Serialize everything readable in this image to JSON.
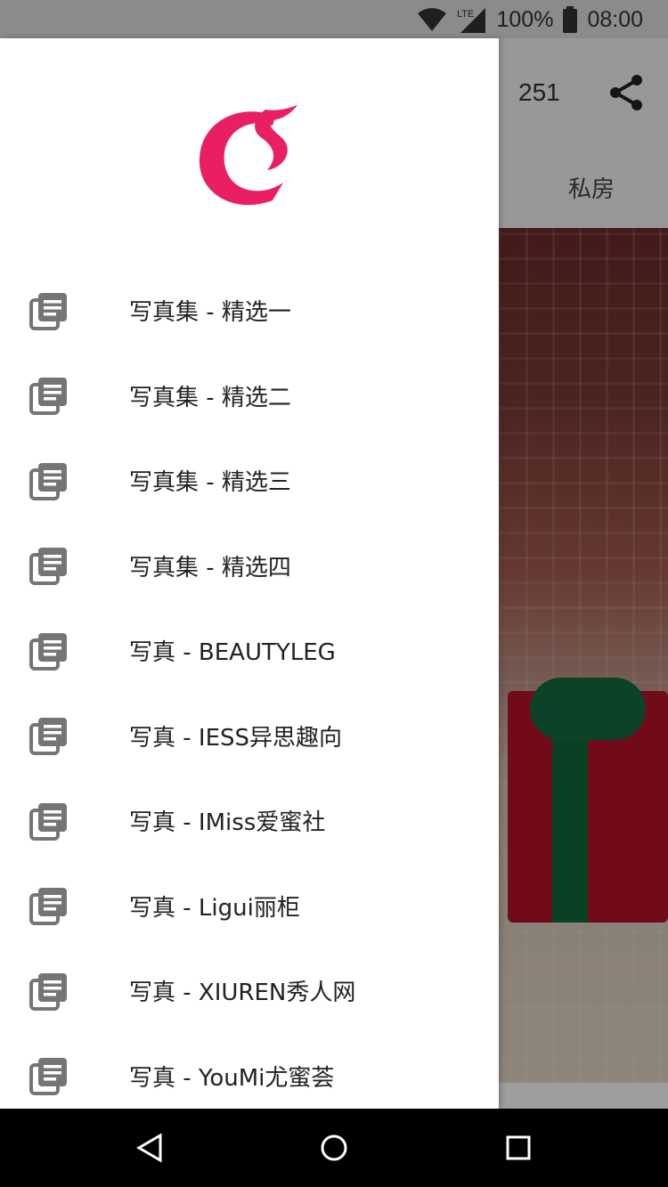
{
  "status_bar": {
    "battery_text": "100%",
    "time": "08:00",
    "network_label": "LTE",
    "icons": [
      "wifi-icon",
      "cell-signal-icon",
      "battery-icon"
    ]
  },
  "background_app": {
    "count_prefix": ":",
    "count": "251",
    "tab_label": "私房",
    "share_icon": "share-icon"
  },
  "drawer": {
    "logo": "app-logo",
    "items": [
      {
        "label": "写真集 - 精选一"
      },
      {
        "label": "写真集 - 精选二"
      },
      {
        "label": "写真集 - 精选三"
      },
      {
        "label": "写真集 - 精选四"
      },
      {
        "label": "写真 - BEAUTYLEG"
      },
      {
        "label": "写真 - IESS异思趣向"
      },
      {
        "label": "写真 - IMiss爱蜜社"
      },
      {
        "label": "写真 - Ligui丽柜"
      },
      {
        "label": "写真 - XIUREN秀人网"
      },
      {
        "label": "写真 - YouMi尤蜜荟"
      }
    ]
  },
  "nav_bar": {
    "icons": [
      "back-icon",
      "home-icon",
      "recents-icon"
    ]
  },
  "colors": {
    "accent": "#e91e63",
    "icon_gray": "#757575",
    "status_bar_bg": "#e0e0e0"
  }
}
